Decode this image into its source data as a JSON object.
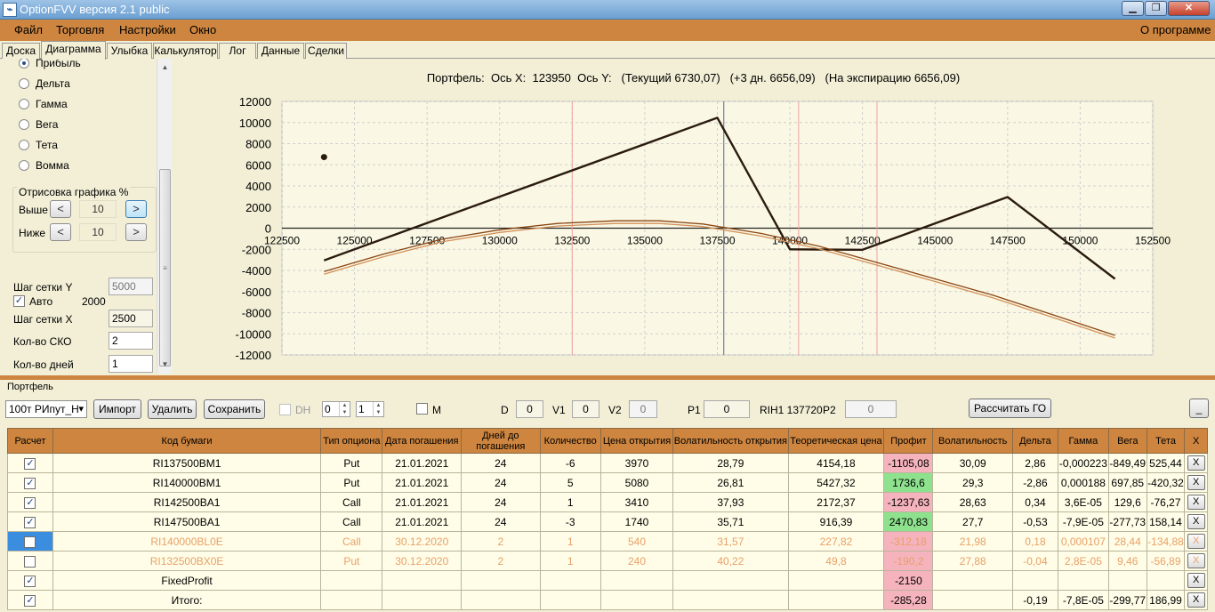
{
  "window": {
    "title": "OptionFVV версия 2.1 public",
    "icon": "app-chart-icon"
  },
  "menu": {
    "items": [
      "Файл",
      "Торговля",
      "Настройки",
      "Окно"
    ],
    "about": "О программе"
  },
  "tabs": [
    "Доска",
    "Диаграмма",
    "Улыбка",
    "Калькулятор",
    "Лог",
    "Данные",
    "Сделки"
  ],
  "active_tab": "Диаграмма",
  "left": {
    "radios": [
      "Прибыль",
      "Дельта",
      "Гамма",
      "Вега",
      "Тета",
      "Вомма"
    ],
    "selected_radio": "Прибыль",
    "draw_group": {
      "title": "Отрисовка графика %",
      "above_label": "Выше",
      "above_value": "10",
      "below_label": "Ниже",
      "below_value": "10",
      "left_arrow": "<",
      "right_arrow": ">"
    },
    "grid_y_label": "Шаг сетки Y",
    "grid_y_value": "5000",
    "auto_label": "Авто",
    "auto_checked": true,
    "auto_value": "2000",
    "grid_x_label": "Шаг сетки X",
    "grid_x_value": "2500",
    "sko_label": "Кол-во СКО",
    "sko_value": "2",
    "days_label": "Кол-во дней",
    "days_value": "1"
  },
  "chart_header": "Портфель:  Ось X:  123950  Ось Y:   (Текущий 6730,07)   (+3 дн. 6656,09)   (На экспирацию 6656,09)",
  "chart_data": {
    "type": "line",
    "xlim": [
      122500,
      152500
    ],
    "ylim": [
      -12000,
      12000
    ],
    "xticks": [
      122500,
      125000,
      127500,
      130000,
      132500,
      135000,
      137500,
      140000,
      142500,
      145000,
      147500,
      150000,
      152500
    ],
    "yticks": [
      12000,
      10000,
      8000,
      6000,
      4000,
      2000,
      0,
      -2000,
      -4000,
      -6000,
      -8000,
      -10000,
      -12000
    ],
    "grid": true,
    "marker_point": {
      "x": 123950,
      "y": 6730
    },
    "crosshair_x": 137720,
    "sigma_lines": [
      132500,
      140300,
      143000
    ],
    "series": [
      {
        "color": "#2a1a10",
        "x": [
          123950,
          137500,
          140000,
          142500,
          147500,
          151200
        ],
        "y": [
          -3050,
          10450,
          -2000,
          -2050,
          2950,
          -4800
        ]
      },
      {
        "color": "#8b4513",
        "x": [
          123950,
          126000,
          128000,
          130000,
          132000,
          134000,
          135500,
          137000,
          139000,
          141000,
          143000,
          145000,
          147000,
          149000,
          151200
        ],
        "y": [
          -4100,
          -2450,
          -1050,
          -150,
          450,
          700,
          700,
          400,
          -500,
          -1700,
          -3250,
          -4800,
          -6350,
          -8150,
          -10150
        ]
      },
      {
        "color": "#d2915a",
        "x": [
          123950,
          126000,
          128000,
          130000,
          132000,
          134000,
          135500,
          137000,
          139000,
          141000,
          143000,
          145000,
          147000,
          149000,
          151200
        ],
        "y": [
          -4350,
          -2700,
          -1300,
          -400,
          200,
          450,
          450,
          150,
          -750,
          -1950,
          -3500,
          -5050,
          -6600,
          -8400,
          -10400
        ]
      }
    ]
  },
  "portfolio": {
    "title": "Портфель",
    "combo_value": "100т РИпут_Н",
    "buttons": [
      "Импорт",
      "Удалить",
      "Сохранить"
    ],
    "dh_label": "DH",
    "spin1": "0",
    "spin2": "1",
    "m_label": "M",
    "d_label": "D",
    "d_value": "0",
    "v1_label": "V1",
    "v1_value": "0",
    "v2_label": "V2",
    "v2_value": "0",
    "p1_label": "P1",
    "p1_value": "0",
    "rih_label": "RIH1 137720",
    "p2_label": "P2",
    "p2_value": "0",
    "calc_go": "Рассчитать ГО",
    "minimize": "_"
  },
  "table": {
    "headers": [
      "Расчет",
      "Код бумаги",
      "Тип опциона",
      "Дата погашения",
      "Дней до погашения",
      "Количество",
      "Цена открытия",
      "Волатильность открытия",
      "Теоретическая цена",
      "Профит",
      "Волатильность",
      "Дельта",
      "Гамма",
      "Вега",
      "Тета",
      "X"
    ],
    "rows": [
      {
        "checked": true,
        "cells": [
          "RI137500BM1",
          "Put",
          "21.01.2021",
          "24",
          "-6",
          "3970",
          "28,79",
          "4154,18",
          "-1105,08",
          "30,09",
          "2,86",
          "-0,000223",
          "-849,49",
          "525,44"
        ],
        "profit_state": "neg",
        "active": true
      },
      {
        "checked": true,
        "cells": [
          "RI140000BM1",
          "Put",
          "21.01.2021",
          "24",
          "5",
          "5080",
          "26,81",
          "5427,32",
          "1736,6",
          "29,3",
          "-2,86",
          "0,000188",
          "697,85",
          "-420,32"
        ],
        "profit_state": "pos",
        "active": true
      },
      {
        "checked": true,
        "cells": [
          "RI142500BA1",
          "Call",
          "21.01.2021",
          "24",
          "1",
          "3410",
          "37,93",
          "2172,37",
          "-1237,63",
          "28,63",
          "0,34",
          "3,6E-05",
          "129,6",
          "-76,27"
        ],
        "profit_state": "neg",
        "active": true
      },
      {
        "checked": true,
        "cells": [
          "RI147500BA1",
          "Call",
          "21.01.2021",
          "24",
          "-3",
          "1740",
          "35,71",
          "916,39",
          "2470,83",
          "27,7",
          "-0,53",
          "-7,9E-05",
          "-277,73",
          "158,14"
        ],
        "profit_state": "pos",
        "active": true
      },
      {
        "checked": false,
        "cells": [
          "RI140000BL0E",
          "Call",
          "30.12.2020",
          "2",
          "1",
          "540",
          "31,57",
          "227,82",
          "-312,18",
          "21,98",
          "0,18",
          "0,000107",
          "28,44",
          "-134,88"
        ],
        "profit_state": "neg",
        "active": false,
        "selected": true
      },
      {
        "checked": false,
        "cells": [
          "RI132500BX0E",
          "Put",
          "30.12.2020",
          "2",
          "1",
          "240",
          "40,22",
          "49,8",
          "-190,2",
          "27,88",
          "-0,04",
          "2,8E-05",
          "9,46",
          "-56,89"
        ],
        "profit_state": "neg",
        "active": false
      },
      {
        "checked": true,
        "cells": [
          "FixedProfit",
          "",
          "",
          "",
          "",
          "",
          "",
          "",
          "-2150",
          "",
          "",
          "",
          "",
          ""
        ],
        "profit_state": "neg",
        "active": true
      },
      {
        "checked": true,
        "cells": [
          "Итого:",
          "",
          "",
          "",
          "",
          "",
          "",
          "",
          "-285,28",
          "",
          "-0,19",
          "-7,8E-05",
          "-299,77",
          "186,99"
        ],
        "profit_state": "neg",
        "active": true
      }
    ],
    "delete_label": "X"
  }
}
